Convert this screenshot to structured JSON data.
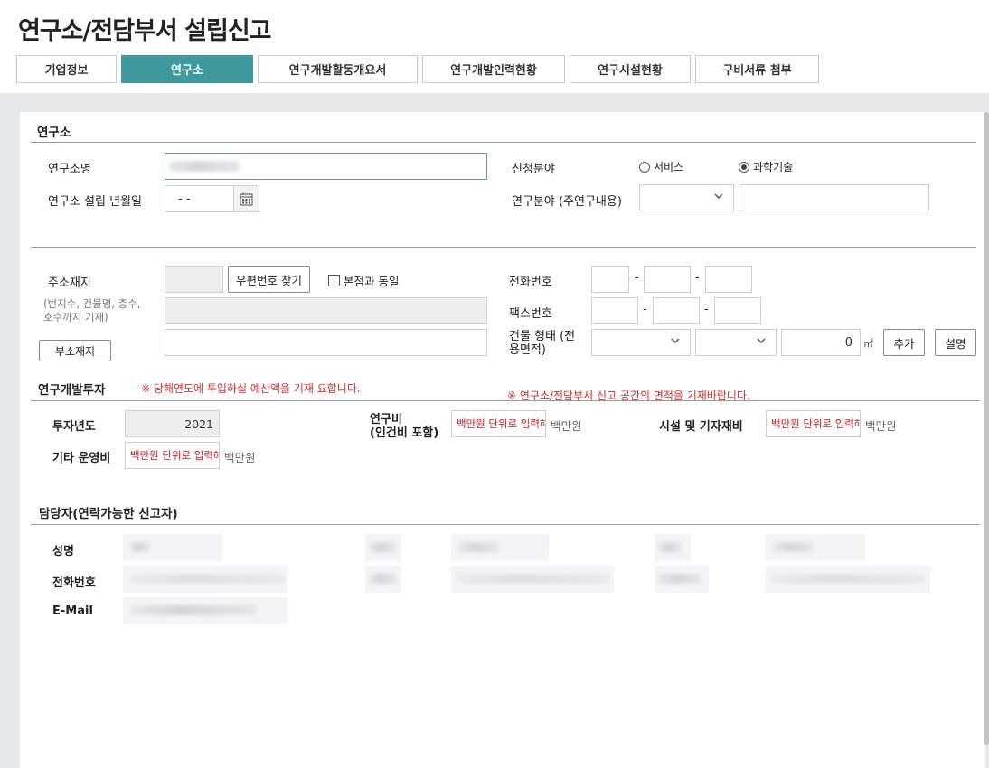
{
  "page": {
    "title": "연구소/전담부서 설립신고"
  },
  "tabs": [
    {
      "label": "기업정보"
    },
    {
      "label": "연구소"
    },
    {
      "label": "연구개발활동개요서"
    },
    {
      "label": "연구개발인력현황"
    },
    {
      "label": "연구시설현황"
    },
    {
      "label": "구비서류 첨부"
    }
  ],
  "lab": {
    "section_title": "연구소",
    "name_label": "연구소명",
    "name_value": "",
    "field_label": "신청분야",
    "field_options": [
      "서비스",
      "과학기술"
    ],
    "field_selected": "과학기술",
    "founded_label": "연구소 설립 년월일",
    "founded_value": "- -",
    "research_field_label": "연구분야 (주연구내용)",
    "address_label": "주소재지",
    "address_note": "(번지수, 건물명, 층수, 호수까지 기재)",
    "postal_button": "우편번호 찾기",
    "same_as_hq_label": "본점과 동일",
    "sub_address_button": "부소재지",
    "phone_label": "전화번호",
    "fax_label": "팩스번호",
    "building_label": "건물 형태 (전용면적)",
    "area_value": "0",
    "area_unit": "㎡",
    "add_button": "추가",
    "explain_button": "설명",
    "area_notice": "※ 연구소/전담부서 신고 공간의 면적을 기재바랍니다."
  },
  "investment": {
    "section_title": "연구개발투자",
    "notice": "※ 당해연도에 투입하실 예산액을 기재 요합니다.",
    "year_label": "투자년도",
    "year_value": "2021",
    "rnd_label_1": "연구비",
    "rnd_label_2": "(인건비 포함)",
    "facility_label": "시설 및 기자재비",
    "other_label": "기타 운영비",
    "placeholder": "백만원 단위로 입력해",
    "unit": "백만원"
  },
  "contact": {
    "section_title": "담당자(연락가능한 신고자)",
    "name_label": "성명",
    "phone_label": "전화번호",
    "email_label": "E-Mail"
  }
}
